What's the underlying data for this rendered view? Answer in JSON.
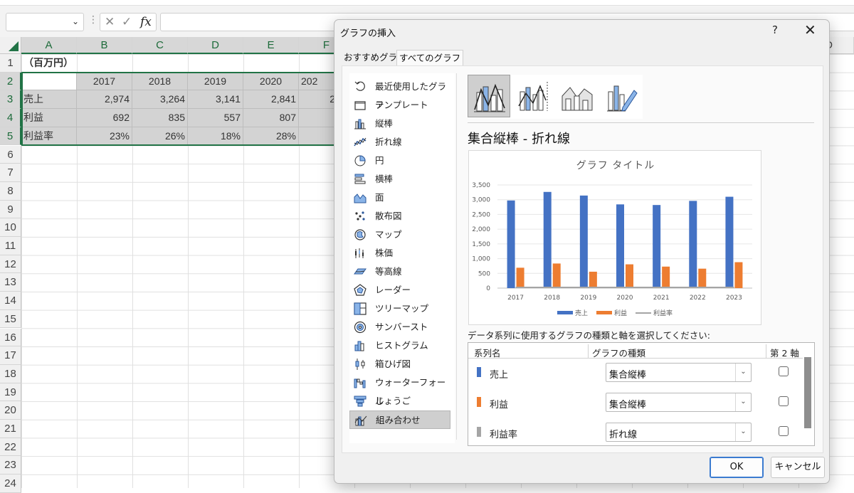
{
  "excel": {
    "name_box": "",
    "fx_label": "fx",
    "columns": [
      "A",
      "B",
      "C",
      "D",
      "E",
      "F",
      "D"
    ],
    "rows": [
      "1",
      "2",
      "3",
      "4",
      "5",
      "6",
      "7",
      "8",
      "9",
      "10",
      "11",
      "12",
      "13",
      "14",
      "15",
      "16",
      "17",
      "18",
      "19",
      "20",
      "21",
      "22",
      "23",
      "24"
    ],
    "cells": {
      "a1": "（百万円）",
      "years": [
        "2017",
        "2018",
        "2019",
        "2020",
        "202"
      ],
      "r3_label": "売上",
      "r3_vals": [
        "2,974",
        "3,264",
        "3,141",
        "2,841",
        "2"
      ],
      "r4_label": "利益",
      "r4_vals": [
        "692",
        "835",
        "557",
        "807",
        ""
      ],
      "r5_label": "利益率",
      "r5_vals": [
        "23%",
        "26%",
        "18%",
        "28%",
        ""
      ]
    }
  },
  "dialog": {
    "title": "グラフの挿入",
    "help": "?",
    "close": "✕",
    "tabs": [
      "おすすめグラフ",
      "すべてのグラフ"
    ],
    "chart_types": [
      {
        "label": "最近使用したグラフ",
        "icon": "recent-icon"
      },
      {
        "label": "テンプレート",
        "icon": "folder-icon"
      },
      {
        "label": "縦棒",
        "icon": "column-chart-icon"
      },
      {
        "label": "折れ線",
        "icon": "line-chart-icon"
      },
      {
        "label": "円",
        "icon": "pie-chart-icon"
      },
      {
        "label": "横棒",
        "icon": "bar-chart-icon"
      },
      {
        "label": "面",
        "icon": "area-chart-icon"
      },
      {
        "label": "散布図",
        "icon": "scatter-chart-icon"
      },
      {
        "label": "マップ",
        "icon": "map-chart-icon"
      },
      {
        "label": "株価",
        "icon": "stock-chart-icon"
      },
      {
        "label": "等高線",
        "icon": "surface-chart-icon"
      },
      {
        "label": "レーダー",
        "icon": "radar-chart-icon"
      },
      {
        "label": "ツリーマップ",
        "icon": "treemap-chart-icon"
      },
      {
        "label": "サンバースト",
        "icon": "sunburst-chart-icon"
      },
      {
        "label": "ヒストグラム",
        "icon": "histogram-chart-icon"
      },
      {
        "label": "箱ひげ図",
        "icon": "boxwhisker-chart-icon"
      },
      {
        "label": "ウォーターフォール",
        "icon": "waterfall-chart-icon"
      },
      {
        "label": "じょうご",
        "icon": "funnel-chart-icon"
      },
      {
        "label": "組み合わせ",
        "icon": "combo-chart-icon"
      }
    ],
    "active_type": "組み合わせ",
    "subtype_title": "集合縦棒 - 折れ線",
    "instruction": "データ系列に使用するグラフの種類と軸を選択してください:",
    "series_headers": {
      "name": "系列名",
      "type": "グラフの種類",
      "axis": "第 2 軸"
    },
    "series_rows": [
      {
        "name": "売上",
        "type": "集合縦棒",
        "color": "#4472c4",
        "secondary": false
      },
      {
        "name": "利益",
        "type": "集合縦棒",
        "color": "#ed7d31",
        "secondary": false
      },
      {
        "name": "利益率",
        "type": "折れ線",
        "color": "#a5a5a5",
        "secondary": false
      }
    ],
    "ok": "OK",
    "cancel": "キャンセル"
  },
  "chart_data": {
    "type": "bar",
    "title": "グラフ タイトル",
    "categories": [
      "2017",
      "2018",
      "2019",
      "2020",
      "2021",
      "2022",
      "2023"
    ],
    "series": [
      {
        "name": "売上",
        "kind": "bar",
        "color": "#4472c4",
        "values": [
          2974,
          3264,
          3141,
          2841,
          2820,
          2960,
          3100
        ]
      },
      {
        "name": "利益",
        "kind": "bar",
        "color": "#ed7d31",
        "values": [
          692,
          835,
          557,
          807,
          730,
          660,
          880
        ]
      },
      {
        "name": "利益率",
        "kind": "line",
        "color": "#a5a5a5",
        "values": [
          0.23,
          0.26,
          0.18,
          0.28,
          0.26,
          0.22,
          0.28
        ]
      }
    ],
    "yticks": [
      "0",
      "500",
      "1,000",
      "1,500",
      "2,000",
      "2,500",
      "3,000",
      "3,500"
    ],
    "ylim": [
      0,
      3500
    ],
    "grid": true,
    "legend": "bottom"
  }
}
